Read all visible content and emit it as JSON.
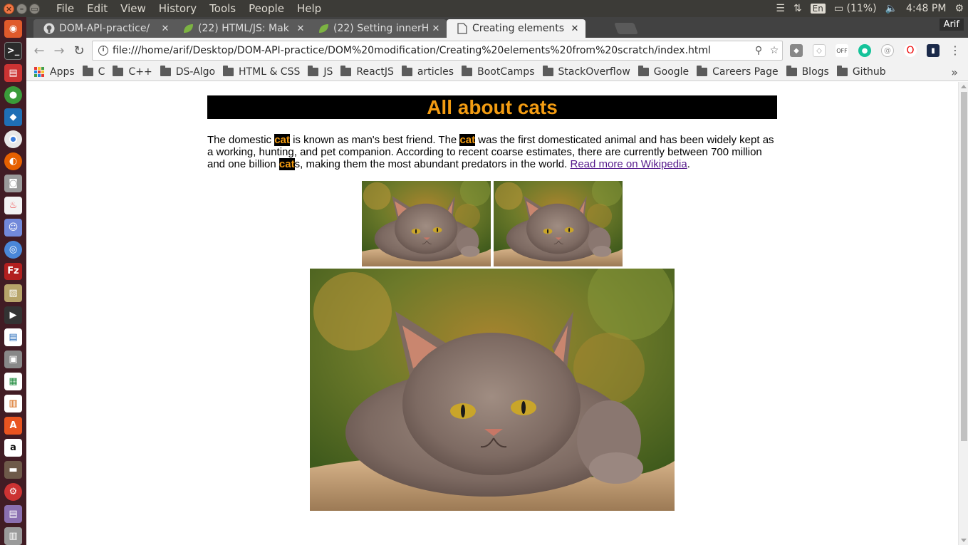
{
  "system": {
    "menu": [
      "File",
      "Edit",
      "View",
      "History",
      "Tools",
      "People",
      "Help"
    ],
    "tray": {
      "lang": "En",
      "battery": "(11%)",
      "time": "4:48 PM"
    }
  },
  "tabs": [
    {
      "title": "DOM-API-practice/",
      "icon": "github-icon"
    },
    {
      "title": "(22) HTML/JS: Mak",
      "icon": "leaf-icon"
    },
    {
      "title": "(22) Setting innerH",
      "icon": "leaf-icon"
    },
    {
      "title": "Creating elements",
      "icon": "page-icon",
      "active": true
    }
  ],
  "profile": "Arif",
  "address": {
    "url": "file:///home/arif/Desktop/DOM-API-practice/DOM%20modification/Creating%20elements%20from%20scratch/index.html"
  },
  "bookmarks": {
    "apps": "Apps",
    "items": [
      "C",
      "C++",
      "DS-Algo",
      "HTML & CSS",
      "JS",
      "ReactJS",
      "articles",
      "BootCamps",
      "StackOverflow",
      "Google",
      "Careers Page",
      "Blogs",
      "Github"
    ]
  },
  "page": {
    "heading": "All about cats",
    "p1": "The domestic ",
    "cat1": "cat",
    "p2": " is known as man's best friend. The ",
    "cat2": "cat",
    "p3": " was the first domesticated animal and has been widely kept as a working, hunting, and pet companion. According to recent coarse estimates, there are currently between 700 million and one billion ",
    "cat3": "cat",
    "p4": "s, making them the most abundant predators in the world. ",
    "link": "Read more on Wikipedia",
    "p5": "."
  },
  "colors": {
    "heading_bg": "#000000",
    "heading_fg": "#f39c12",
    "link": "#551a8b",
    "launcher": "#411c24"
  }
}
